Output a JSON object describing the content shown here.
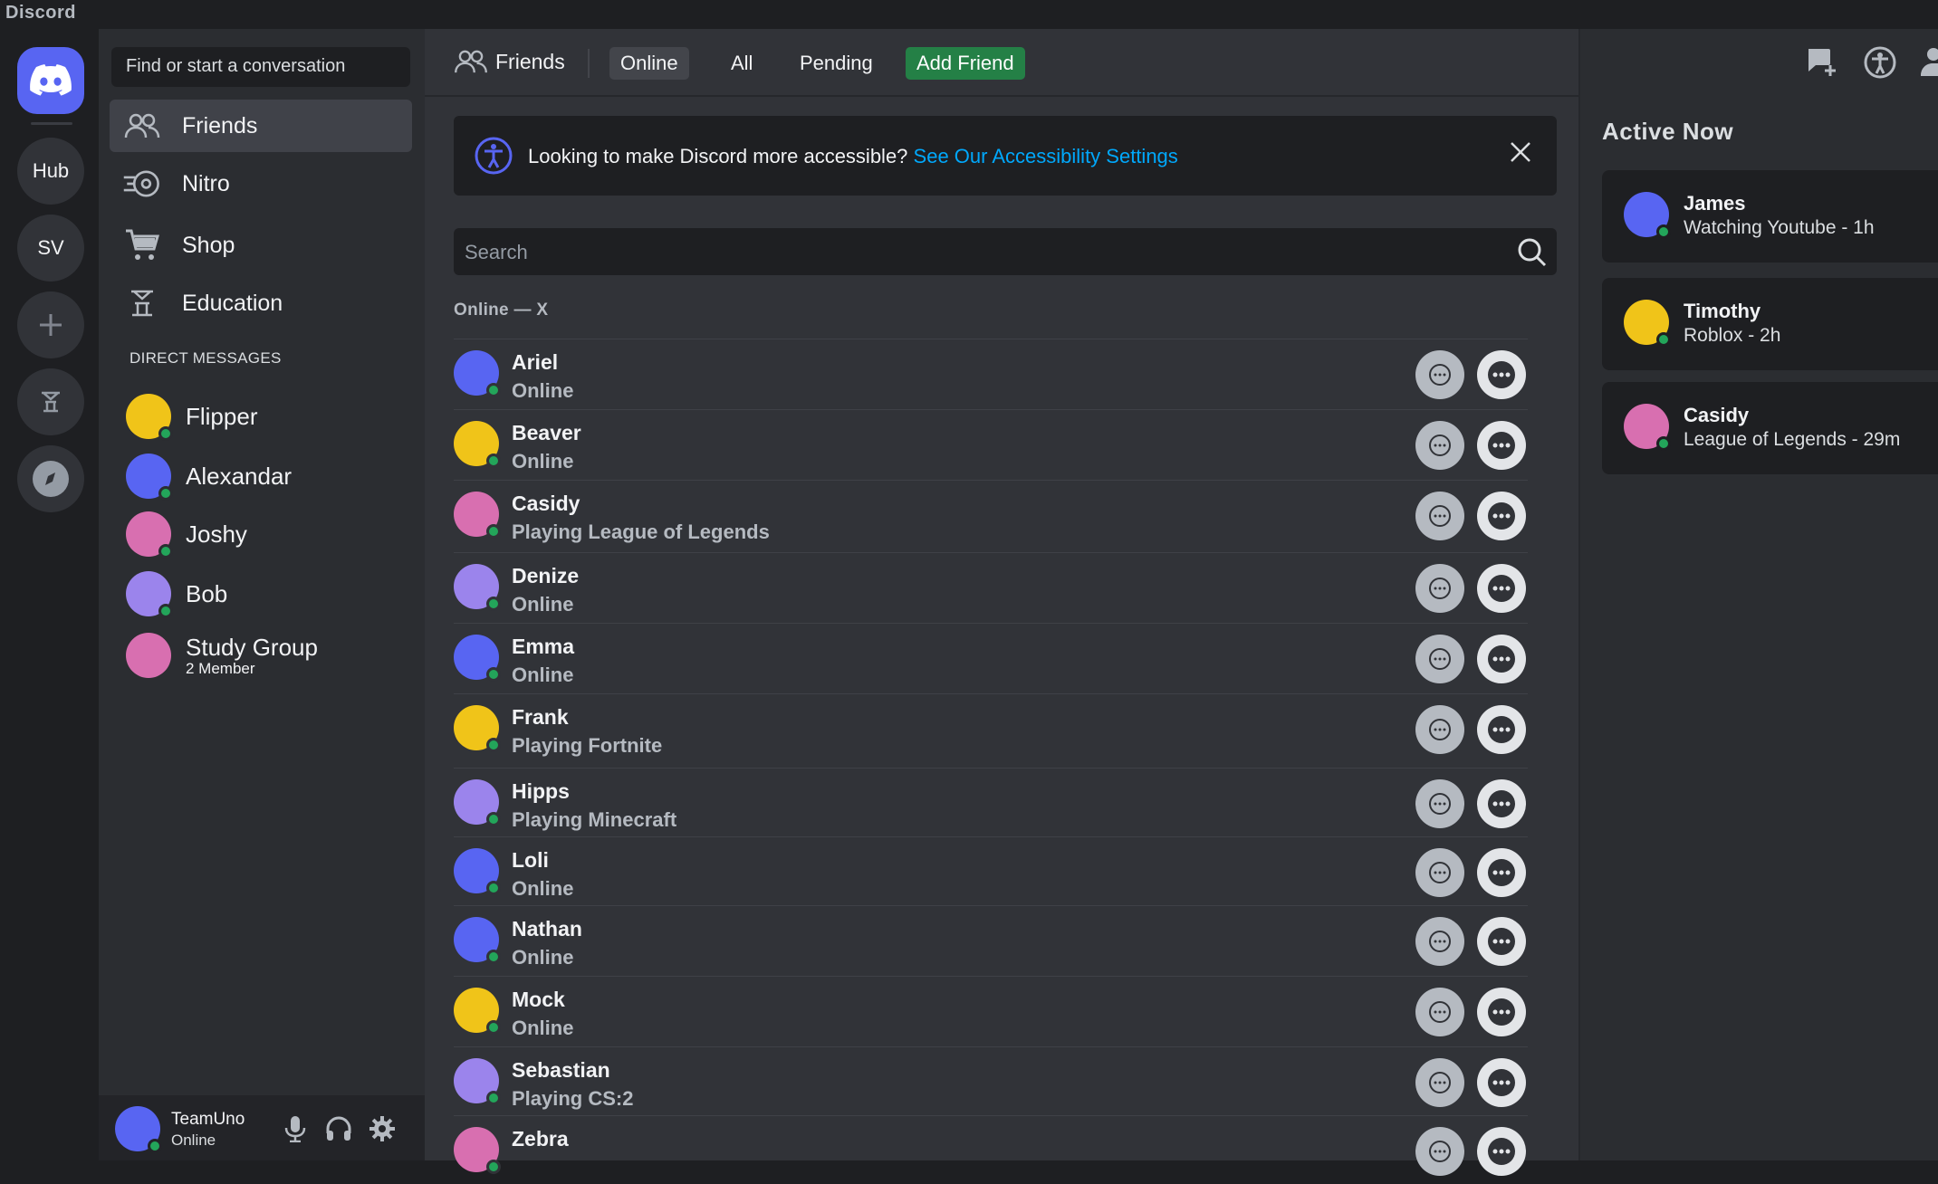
{
  "app": {
    "brand": "Discord"
  },
  "rail": {
    "hub_label": "Hub",
    "server_label": "SV"
  },
  "sidebar": {
    "search_placeholder": "Find or start a conversation",
    "nav": [
      {
        "label": "Friends",
        "icon": "friends-icon"
      },
      {
        "label": "Nitro",
        "icon": "nitro-icon"
      },
      {
        "label": "Shop",
        "icon": "shop-icon"
      },
      {
        "label": "Education",
        "icon": "education-icon"
      }
    ],
    "dm_header": "DIRECT MESSAGES",
    "dms": [
      {
        "name": "Flipper",
        "color": "#f0c419"
      },
      {
        "name": "Alexandar",
        "color": "#5865f2"
      },
      {
        "name": "Joshy",
        "color": "#d86fb0"
      },
      {
        "name": "Bob",
        "color": "#9b84ec"
      },
      {
        "name": "Study Group",
        "sub": "2 Member",
        "color": "#d86fb0"
      }
    ],
    "user": {
      "name": "TeamUno",
      "status": "Online"
    }
  },
  "topbar": {
    "friends_label": "Friends",
    "tabs": [
      "Online",
      "All",
      "Pending"
    ],
    "add_friend_label": "Add Friend"
  },
  "banner": {
    "text": "Looking to make Discord more accessible?",
    "link": "See Our Accessibility Settings"
  },
  "friends_search": {
    "placeholder": "Search"
  },
  "online_count_label": "Online — X",
  "friends": [
    {
      "name": "Ariel",
      "status": "Online",
      "color": "#5865f2"
    },
    {
      "name": "Beaver",
      "status": "Online",
      "color": "#f0c419"
    },
    {
      "name": "Casidy",
      "status": "Playing League of Legends",
      "color": "#d86fb0"
    },
    {
      "name": "Denize",
      "status": "Online",
      "color": "#9b84ec"
    },
    {
      "name": "Emma",
      "status": "Online",
      "color": "#5865f2"
    },
    {
      "name": "Frank",
      "status": "Playing Fortnite",
      "color": "#f0c419"
    },
    {
      "name": "Hipps",
      "status": "Playing Minecraft",
      "color": "#9b84ec"
    },
    {
      "name": "Loli",
      "status": "Online",
      "color": "#5865f2"
    },
    {
      "name": "Nathan",
      "status": "Online",
      "color": "#5865f2"
    },
    {
      "name": "Mock",
      "status": "Online",
      "color": "#f0c419"
    },
    {
      "name": "Sebastian",
      "status": "Playing CS:2",
      "color": "#9b84ec"
    },
    {
      "name": "Zebra",
      "status": "",
      "color": "#d86fb0"
    }
  ],
  "active_now": {
    "title": "Active Now",
    "items": [
      {
        "name": "James",
        "activity": "Watching Youtube - 1h",
        "color": "#5865f2"
      },
      {
        "name": "Timothy",
        "activity": "Roblox - 2h",
        "color": "#f0c419"
      },
      {
        "name": "Casidy",
        "activity": "League of Legends - 29m",
        "color": "#d86fb0"
      }
    ]
  }
}
